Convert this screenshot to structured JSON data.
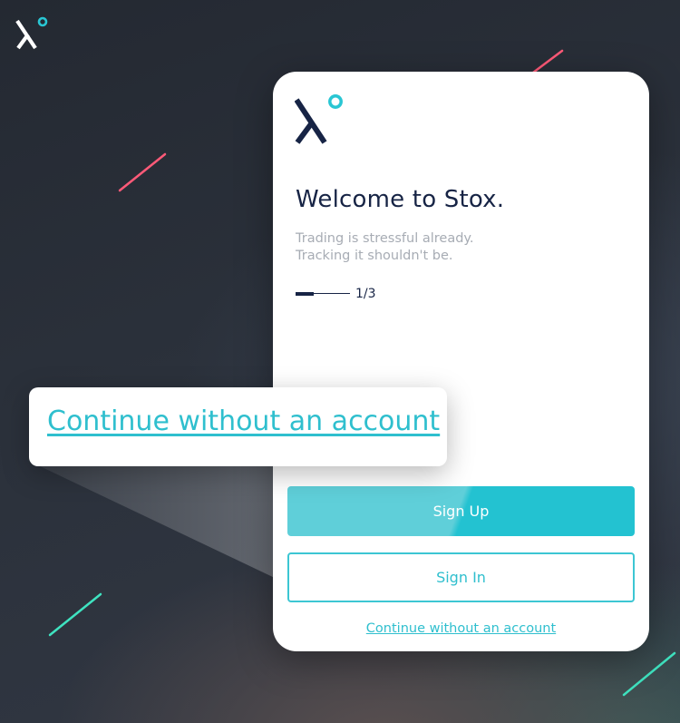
{
  "brand": {
    "logo_icon": "stox-x-logo",
    "accent_color": "#23c2d1",
    "navy_color": "#172445"
  },
  "card": {
    "title": "Welcome to Stox.",
    "tagline_line1": "Trading is stressful already.",
    "tagline_line2": "Tracking it shouldn't be.",
    "progress": {
      "label": "1/3",
      "fraction": 0.333
    },
    "signup_label": "Sign Up",
    "signin_label": "Sign In",
    "continue_label": "Continue without an account"
  },
  "callout": {
    "label": "Continue without an account"
  }
}
